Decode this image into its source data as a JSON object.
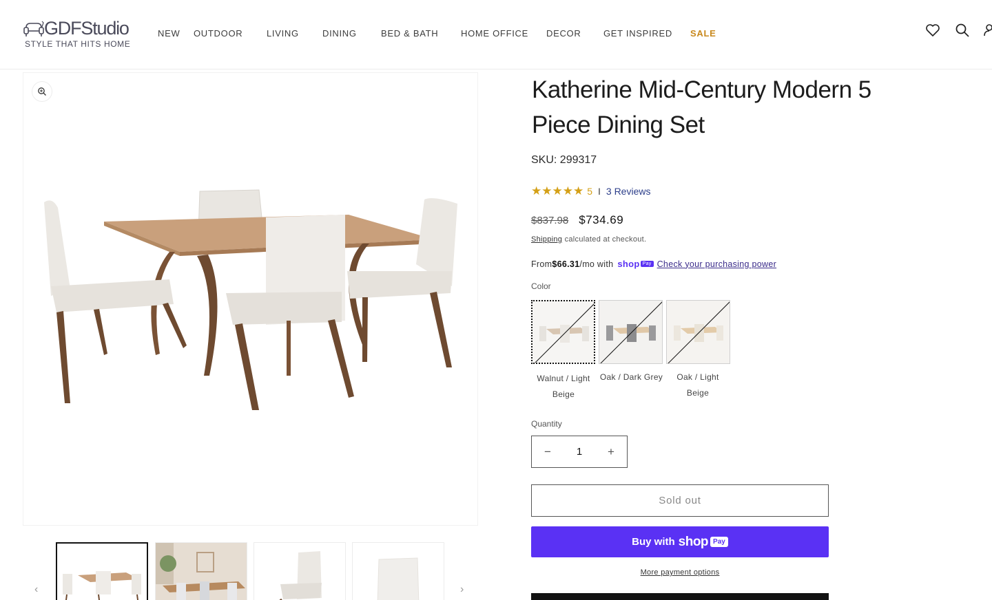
{
  "brand": {
    "name": "GDFStudio",
    "tagline": "STYLE THAT HITS HOME"
  },
  "nav": {
    "items": [
      "NEW",
      "OUTDOOR",
      "LIVING",
      "DINING",
      "BED & BATH",
      "HOME OFFICE",
      "DECOR",
      "GET INSPIRED",
      "SALE"
    ]
  },
  "header_icons": [
    "heart-icon",
    "search-icon",
    "account-icon"
  ],
  "product": {
    "title": "Katherine Mid-Century Modern 5 Piece Dining Set",
    "sku": "SKU: 299317",
    "rating": {
      "stars": "★★★★★",
      "value": "5",
      "separator": "I",
      "reviews_label": "3 Reviews"
    },
    "price_original": "$837.98",
    "price_sale": "$734.69",
    "shipping_link": "Shipping",
    "shipping_text": " calculated at checkout.",
    "installments": {
      "prefix": "From ",
      "amount": "$66.31",
      "suffix": "/mo with ",
      "shop_word": "shop",
      "pay_word": "Pay",
      "link": "Check your purchasing power"
    },
    "color_label": "Color",
    "colors": [
      {
        "line1": "Walnut / Light",
        "line2": "Beige",
        "selected": true
      },
      {
        "line1": "Oak / Dark Grey",
        "line2": "",
        "selected": false
      },
      {
        "line1": "Oak / Light",
        "line2": "Beige",
        "selected": false
      }
    ],
    "quantity_label": "Quantity",
    "quantity": "1",
    "qty_minus": "−",
    "qty_plus": "+",
    "sold_out_label": "Sold out",
    "buy_with_label": "Buy with",
    "buy_shop": "shop",
    "buy_pay": "Pay",
    "more_payment": "More payment options"
  },
  "gallery": {
    "prev_arrow": "‹",
    "next_arrow": "›",
    "thumbnail_count": 4
  },
  "colors": {
    "sale": "#c8891e",
    "shop_pay": "#5a31f4",
    "star": "#d4a017",
    "review_link": "#2c3e8a"
  }
}
